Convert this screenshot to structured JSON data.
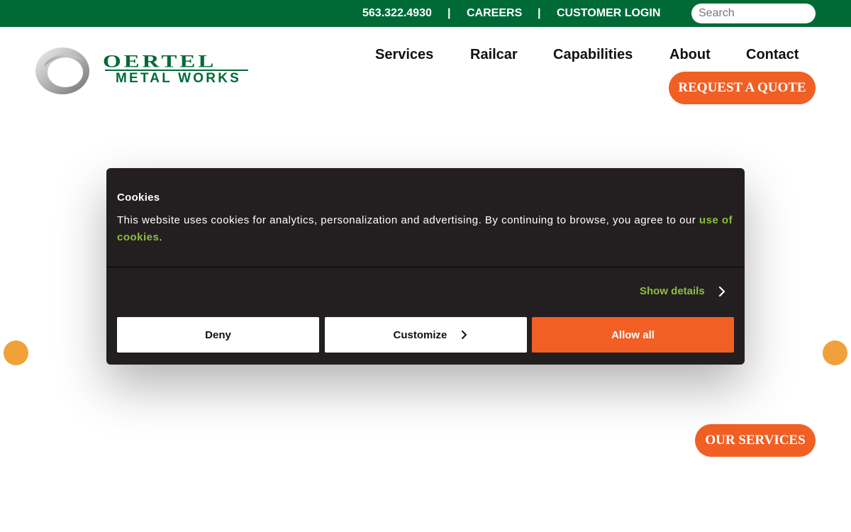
{
  "topbar": {
    "phone": "563.322.4930",
    "separator": "|",
    "careers": "CAREERS",
    "customer_login": "CUSTOMER LOGIN",
    "search_placeholder": "Search"
  },
  "logo": {
    "line1": "OERTEL",
    "line2": "METAL WORKS"
  },
  "nav": {
    "items": [
      "Services",
      "Railcar",
      "Capabilities",
      "About",
      "Contact"
    ],
    "quote_button": "REQUEST A QUOTE"
  },
  "hero": {
    "services_button": "OUR SERVICES"
  },
  "cookie_banner": {
    "title": "Cookies",
    "text": "This website uses cookies for analytics, personalization and advertising. By continuing to browse, you agree to our ",
    "link": "use of cookies",
    "text_end": ".",
    "show_details": "Show details",
    "deny": "Deny",
    "customize": "Customize",
    "allow_all": "Allow all"
  },
  "colors": {
    "brand_green": "#006a37",
    "accent_orange": "#f15f24",
    "link_green": "#8cbf3f",
    "banner_bg": "#231f20",
    "carousel_dot": "#f0a13a"
  }
}
